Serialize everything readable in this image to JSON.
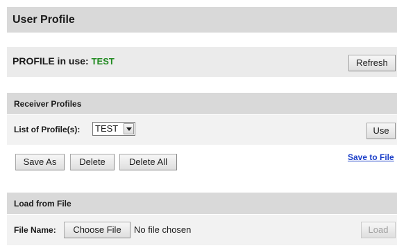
{
  "title": "User Profile",
  "status": {
    "label": "PROFILE in use:",
    "value": "TEST",
    "value_color": "#1f8a1f",
    "refresh_label": "Refresh"
  },
  "receiver": {
    "header": "Receiver Profiles",
    "list_label": "List of Profile(s):",
    "selected_profile": "TEST",
    "use_label": "Use",
    "save_as_label": "Save As",
    "delete_label": "Delete",
    "delete_all_label": "Delete All",
    "save_to_file_label": "Save to File"
  },
  "load": {
    "header": "Load from File",
    "file_name_label": "File Name:",
    "choose_file_label": "Choose File",
    "no_file_text": "No file chosen",
    "load_label": "Load"
  },
  "icons": {
    "select_arrow": "chevron-down-icon"
  }
}
